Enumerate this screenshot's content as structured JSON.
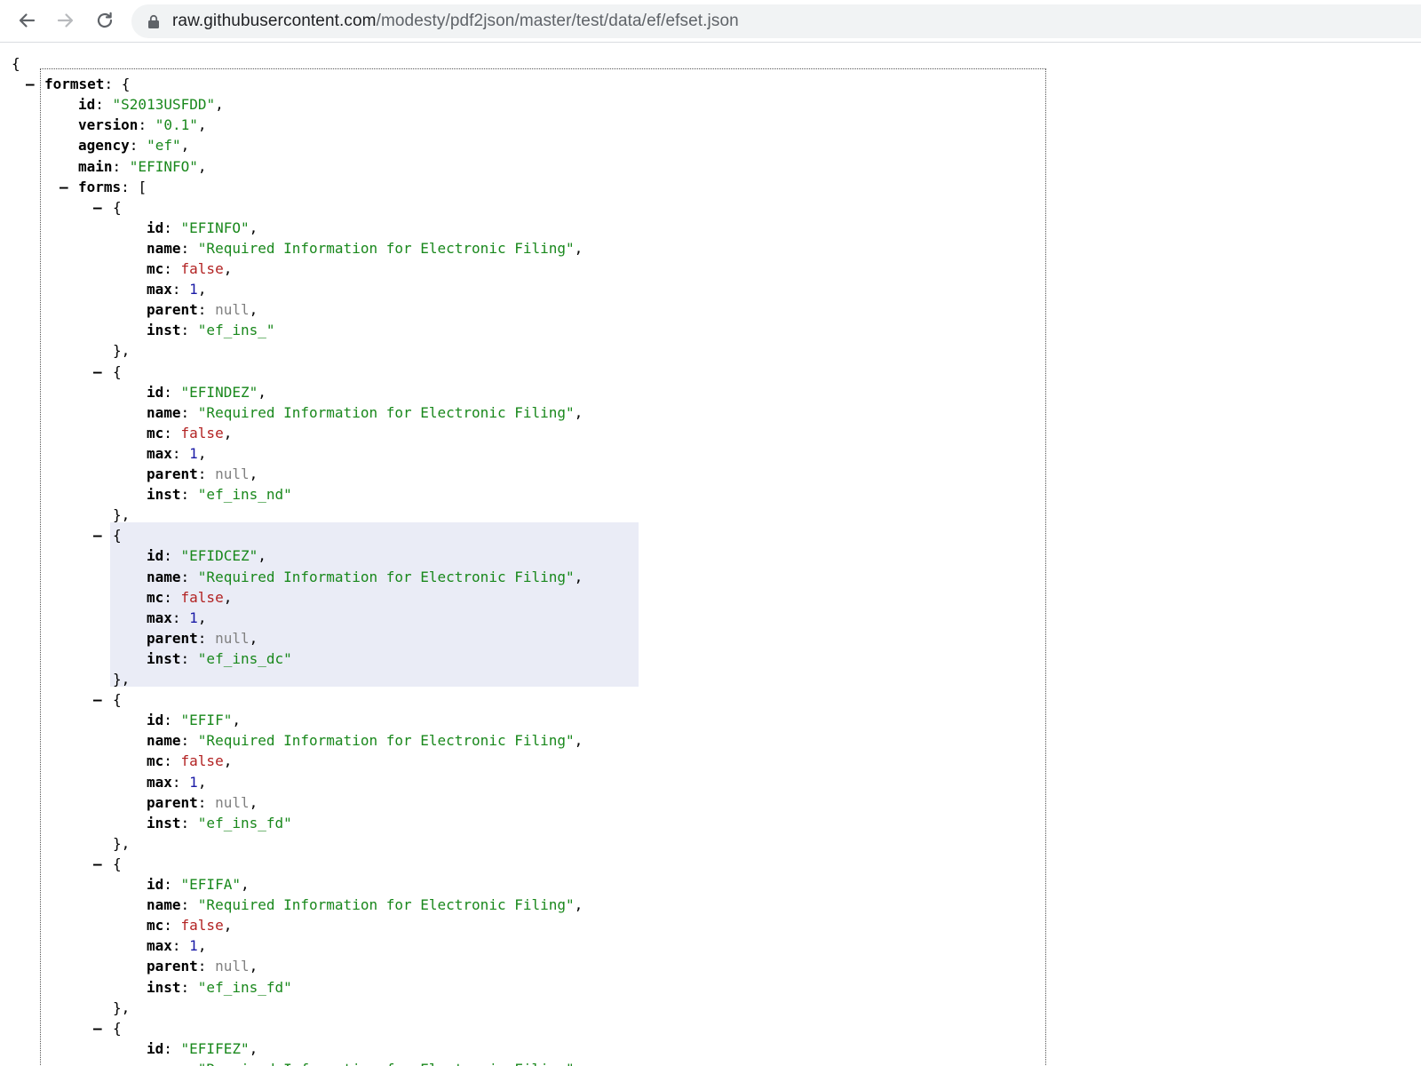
{
  "browser": {
    "url_host": "raw.githubusercontent.com",
    "url_path": "/modesty/pdf2json/master/test/data/ef/efset.json"
  },
  "json": {
    "open_brace": "{",
    "root_key": "formset",
    "formset": {
      "id": "\"S2013USFDD\"",
      "version": "\"0.1\"",
      "agency": "\"ef\"",
      "main": "\"EFINFO\""
    },
    "forms_key": "forms",
    "key_labels": {
      "id": "id",
      "version": "version",
      "agency": "agency",
      "main": "main",
      "name": "name",
      "mc": "mc",
      "max": "max",
      "parent": "parent",
      "inst": "inst"
    },
    "forms": [
      {
        "id": "\"EFINFO\"",
        "name": "\"Required Information for Electronic Filing\"",
        "mc": "false",
        "max": "1",
        "parent": "null",
        "inst": "\"ef_ins_\""
      },
      {
        "id": "\"EFINDEZ\"",
        "name": "\"Required Information for Electronic Filing\"",
        "mc": "false",
        "max": "1",
        "parent": "null",
        "inst": "\"ef_ins_nd\""
      },
      {
        "id": "\"EFIDCEZ\"",
        "name": "\"Required Information for Electronic Filing\"",
        "mc": "false",
        "max": "1",
        "parent": "null",
        "inst": "\"ef_ins_dc\""
      },
      {
        "id": "\"EFIF\"",
        "name": "\"Required Information for Electronic Filing\"",
        "mc": "false",
        "max": "1",
        "parent": "null",
        "inst": "\"ef_ins_fd\""
      },
      {
        "id": "\"EFIFA\"",
        "name": "\"Required Information for Electronic Filing\"",
        "mc": "false",
        "max": "1",
        "parent": "null",
        "inst": "\"ef_ins_fd\""
      },
      {
        "id": "\"EFIFEZ\"",
        "name": "\"Required Information for Electronic Filing\""
      }
    ]
  }
}
